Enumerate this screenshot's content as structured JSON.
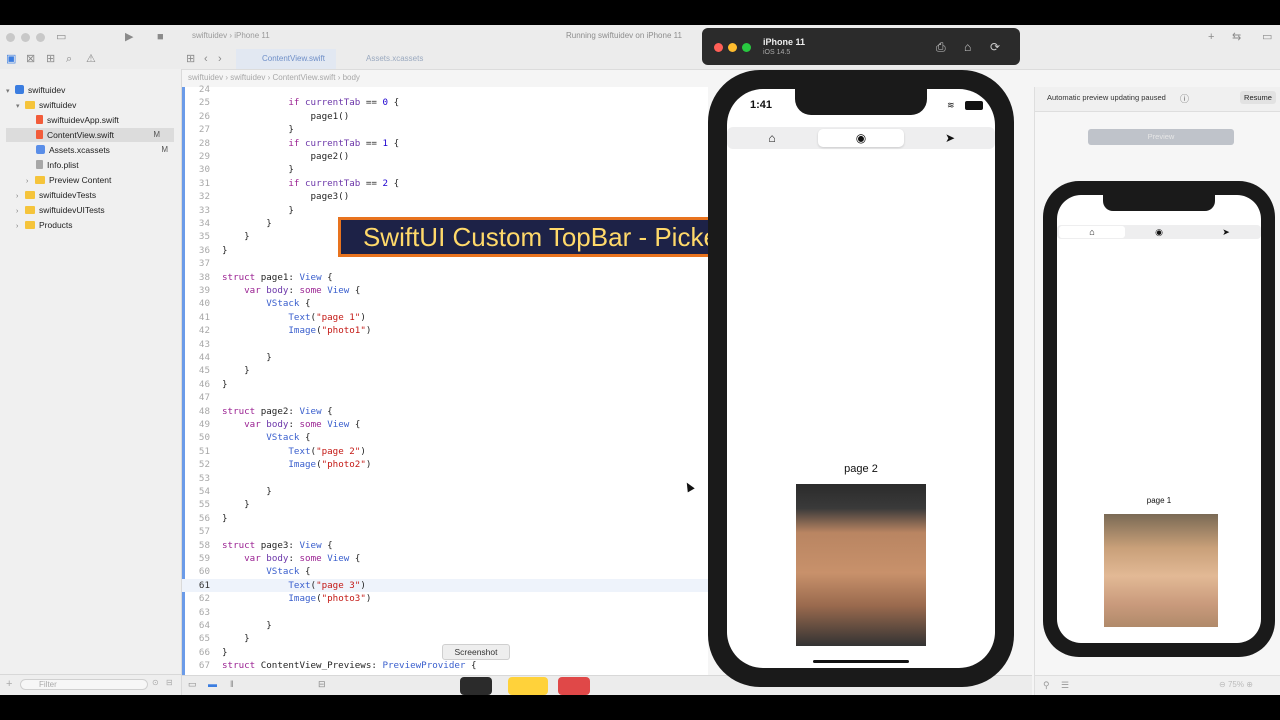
{
  "toolbar": {
    "scheme": "swiftuidev",
    "device": "iPhone 11",
    "activity": "Running swiftuidev on iPhone 11"
  },
  "tabs": [
    {
      "label": "ContentView.swift",
      "active": true
    },
    {
      "label": "Assets.xcassets",
      "active": false
    }
  ],
  "breadcrumb": [
    "swiftuidev",
    "swiftuidev",
    "ContentView.swift",
    "body"
  ],
  "navigator": {
    "items": [
      {
        "label": "swiftuidev",
        "type": "project",
        "badge": ""
      },
      {
        "label": "swiftuidev",
        "type": "folder",
        "badge": ""
      },
      {
        "label": "swiftuidevApp.swift",
        "type": "swift",
        "badge": ""
      },
      {
        "label": "ContentView.swift",
        "type": "swift",
        "badge": "M"
      },
      {
        "label": "Assets.xcassets",
        "type": "asset",
        "badge": "M"
      },
      {
        "label": "Info.plist",
        "type": "plist",
        "badge": ""
      },
      {
        "label": "Preview Content",
        "type": "folder",
        "badge": ""
      },
      {
        "label": "swiftuidevTests",
        "type": "folder",
        "badge": ""
      },
      {
        "label": "swiftuidevUITests",
        "type": "folder",
        "badge": ""
      },
      {
        "label": "Products",
        "type": "folder",
        "badge": ""
      }
    ],
    "filter_placeholder": "Filter"
  },
  "code": {
    "current_line": "61",
    "lines": [
      {
        "n": "24",
        "text": ""
      },
      {
        "n": "25",
        "text": "            if currentTab == 0 {"
      },
      {
        "n": "26",
        "text": "                page1()"
      },
      {
        "n": "27",
        "text": "            }"
      },
      {
        "n": "28",
        "text": "            if currentTab == 1 {"
      },
      {
        "n": "29",
        "text": "                page2()"
      },
      {
        "n": "30",
        "text": "            }"
      },
      {
        "n": "31",
        "text": "            if currentTab == 2 {"
      },
      {
        "n": "32",
        "text": "                page3()"
      },
      {
        "n": "33",
        "text": "            }"
      },
      {
        "n": "34",
        "text": "        }"
      },
      {
        "n": "35",
        "text": "    }"
      },
      {
        "n": "36",
        "text": "}"
      },
      {
        "n": "37",
        "text": ""
      },
      {
        "n": "38",
        "text": "struct page1: View {"
      },
      {
        "n": "39",
        "text": "    var body: some View {"
      },
      {
        "n": "40",
        "text": "        VStack {"
      },
      {
        "n": "41",
        "text": "            Text(\"page 1\")"
      },
      {
        "n": "42",
        "text": "            Image(\"photo1\")"
      },
      {
        "n": "43",
        "text": ""
      },
      {
        "n": "44",
        "text": "        }"
      },
      {
        "n": "45",
        "text": "    }"
      },
      {
        "n": "46",
        "text": "}"
      },
      {
        "n": "47",
        "text": ""
      },
      {
        "n": "48",
        "text": "struct page2: View {"
      },
      {
        "n": "49",
        "text": "    var body: some View {"
      },
      {
        "n": "50",
        "text": "        VStack {"
      },
      {
        "n": "51",
        "text": "            Text(\"page 2\")"
      },
      {
        "n": "52",
        "text": "            Image(\"photo2\")"
      },
      {
        "n": "53",
        "text": ""
      },
      {
        "n": "54",
        "text": "        }"
      },
      {
        "n": "55",
        "text": "    }"
      },
      {
        "n": "56",
        "text": "}"
      },
      {
        "n": "57",
        "text": ""
      },
      {
        "n": "58",
        "text": "struct page3: View {"
      },
      {
        "n": "59",
        "text": "    var body: some View {"
      },
      {
        "n": "60",
        "text": "        VStack {"
      },
      {
        "n": "61",
        "text": "            Text(\"page 3\")"
      },
      {
        "n": "62",
        "text": "            Image(\"photo3\")"
      },
      {
        "n": "63",
        "text": ""
      },
      {
        "n": "64",
        "text": "        }"
      },
      {
        "n": "65",
        "text": "    }"
      },
      {
        "n": "66",
        "text": "}"
      },
      {
        "n": "67",
        "text": "struct ContentView_Previews: PreviewProvider {"
      }
    ]
  },
  "banner": "SwiftUI Custom TopBar - Picker In SwiftUI",
  "tooltip": "Screenshot",
  "simulator": {
    "device": "iPhone 11",
    "os": "iOS 14.5",
    "time": "1:41",
    "selected_segment": 1,
    "page_label": "page 2"
  },
  "preview": {
    "status": "Automatic preview updating paused",
    "resume": "Resume",
    "button": "Preview",
    "page_label": "page 1",
    "selected_segment": 0,
    "zoom": "75%"
  },
  "colors": {
    "banner_bg": "#1d2247",
    "banner_border": "#e8731e",
    "banner_text": "#ffd96a",
    "accent": "#3b7de0"
  }
}
